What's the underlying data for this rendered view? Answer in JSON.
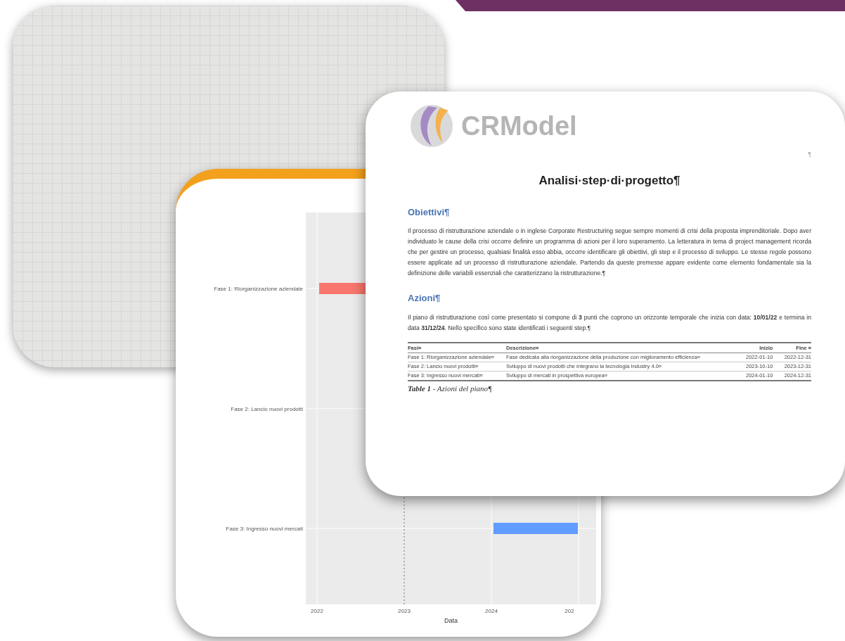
{
  "chart_card": {
    "gantt": {
      "xlabel": "Data",
      "rows": [
        {
          "label": "Fase 1: Riorganizzazione aziendale",
          "color": "#f8766d"
        },
        {
          "label": "Fase 2: Lancio nuovi prodotti"
        },
        {
          "label": "Fase 3: Ingresso nuovi mercati",
          "color": "#619cff"
        }
      ],
      "ticks": [
        {
          "label": "2022",
          "dashed": false
        },
        {
          "label": "2023",
          "dashed": true
        },
        {
          "label": "2024",
          "dashed": false
        },
        {
          "label": "202",
          "dashed": false
        }
      ]
    }
  },
  "document": {
    "logo_text": "CRModel",
    "corner_mark": "¶",
    "title": "Analisi·step·di·progetto¶",
    "sections": [
      {
        "heading": "Obiettivi¶",
        "paragraph": "Il processo di ristrutturazione aziendale o in inglese Corporate Restructuring segue sempre momenti di crisi della proposta imprenditoriale. Dopo aver individuato le cause della crisi occorre definire un programma di azioni per il loro superamento. La letteratura in tema di project management ricorda che per gestire un processo, qualsiasi finalità esso abbia, occorre identificare gli obiettivi, gli step e il processo di sviluppo. Le stesse regole possono essere applicate ad un processo di ristrutturazione aziendale. Partendo da queste premesse appare evidente come elemento fondamentale sia la definizione delle variabili essenziali che caratterizzano la ristrutturazione.¶"
      },
      {
        "heading": "Azioni¶",
        "paragraph": "Il piano di ristrutturazione così come presentato si compone di **3** punti che coprono un orizzonte temporale che inizia con data: **10/01/22** e termina in data **31/12/24**. Nello specifico sono state identificati i seguenti step.¶"
      }
    ],
    "table": {
      "columns": [
        "Fasi¤",
        "Descrizione¤",
        "Inizio",
        "Fine ¤"
      ],
      "rows": [
        [
          "Fase 1: Riorganizzazione aziendale¤",
          "Fase dedicata alla riorganizzazione della produzione con miglioramento efficienza¤",
          "2022-01-10",
          "2022-12-31"
        ],
        [
          "Fase 2: Lancio nuovi prodotti¤",
          "Sviluppo di nuovi prodotti che integrano la tecnologia Industry 4.0¤",
          "2023-10-10",
          "2023-12-31"
        ],
        [
          "Fase 3: Ingresso nuovi mercati¤",
          "Sviluppo di mercati in prospettiva europea¤",
          "2024-01-10",
          "2024-12-31"
        ]
      ]
    },
    "caption": "**Table 1** - Azioni del piano¶"
  }
}
